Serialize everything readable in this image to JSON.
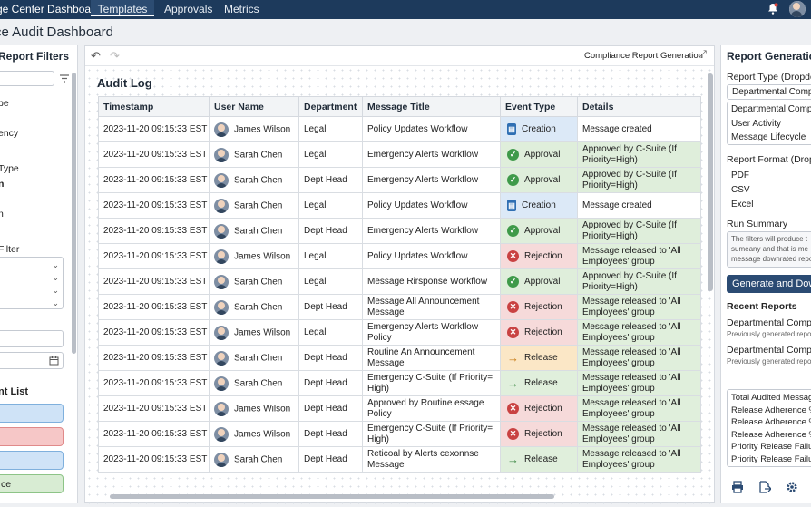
{
  "topbar": {
    "title": "ge Center Dashboard",
    "tabs": [
      "Templates",
      "Approvals",
      "Metrics"
    ]
  },
  "page_title": "ce Audit Dashboard",
  "left": {
    "heading": "Report Filters",
    "frag1": "pe",
    "frag2": "ency",
    "frag3": "Type",
    "frag4": "n",
    "frag5": "l",
    "frag6": "n",
    "filter_label": "Filter",
    "list_label": "nt List",
    "chip4": "ce"
  },
  "middle": {
    "breadcrumb": "Compliance Report Generation",
    "title": "Audit Log",
    "columns": [
      "Timestamp",
      "User Name",
      "Department",
      "Message Title",
      "Event Type",
      "Details"
    ],
    "rows": [
      [
        "2023-11-20 09:15:33 EST",
        "James Wilson",
        "Legal",
        "Policy Updates Workflow",
        "Creation",
        "Message created"
      ],
      [
        "2023-11-20 09:15:33 EST",
        "Sarah Chen",
        "Legal",
        "Emergency Alerts Workflow",
        "Approval",
        "Approved by C-Suite (If Priority=High)"
      ],
      [
        "2023-11-20 09:15:33 EST",
        "Sarah Chen",
        "Dept Head",
        "Emergency Alerts Workflow",
        "Approval",
        "Approved by C-Suite (If Priority=High)"
      ],
      [
        "2023-11-20 09:15:33 EST",
        "Sarah Chen",
        "Legal",
        "Policy Updates Workflow",
        "Creation",
        "Message created"
      ],
      [
        "2023-11-20 09:15:33 EST",
        "Sarah Chen",
        "Dept Head",
        "Emergency Alerts Workflow",
        "Approval",
        "Approved by C-Suite (If Priority=High)"
      ],
      [
        "2023-11-20 09:15:33 EST",
        "James Wilson",
        "Legal",
        "Policy Updates Workflow",
        "Rejection",
        "Message released to 'All Employees' group"
      ],
      [
        "2023-11-20 09:15:33 EST",
        "Sarah Chen",
        "Legal",
        "Message Rirsponse Workflow",
        "Approval",
        "Approved by C-Suite (If Priority=High)"
      ],
      [
        "2023-11-20 09:15:33 EST",
        "Sarah Chen",
        "Dept Head",
        "Message All Announcement Message",
        "Rejection",
        "Message released to 'All Employees' group"
      ],
      [
        "2023-11-20 09:15:33 EST",
        "James Wilson",
        "Legal",
        "Emergency Alerts Workflow Policy",
        "Rejection",
        "Message released to 'All Employees' group"
      ],
      [
        "2023-11-20 09:15:33 EST",
        "Sarah Chen",
        "Dept Head",
        "Routine An Announcement Message",
        "Release",
        "Message released to 'All Employees' group"
      ],
      [
        "2023-11-20 09:15:33 EST",
        "Sarah Chen",
        "Dept Head",
        "Emergency C-Suite (If Priority= High)",
        "Release",
        "Message released to 'All Employees' group"
      ],
      [
        "2023-11-20 09:15:33 EST",
        "James Wilson",
        "Dept Head",
        "Approved by Routine essage Policy",
        "Rejection",
        "Message released to 'All Employees' group"
      ],
      [
        "2023-11-20 09:15:33 EST",
        "James Wilson",
        "Dept Head",
        "Emergency C-Suite (If Priority= High)",
        "Rejection",
        "Message released to 'All Employees' group"
      ],
      [
        "2023-11-20 09:15:33 EST",
        "Sarah Chen",
        "Dept Head",
        "Reticoal by Alerts cexonnse Message",
        "Release",
        "Message released to 'All Employees' group"
      ]
    ]
  },
  "right": {
    "heading": "Report Generation",
    "type_label": "Report Type (Dropdow",
    "type_selected": "Departmental Complia",
    "type_opts": [
      "Departmental Complia",
      "User Activity",
      "Message Lifecycle"
    ],
    "format_label": "Report Format (Dropdo",
    "format_opts": [
      "PDF",
      "CSV",
      "Excel"
    ],
    "summary_label": "Run Summary",
    "summary_text": [
      "The filters will produce t",
      "sumeany and that is me",
      "message downrated repo"
    ],
    "gen_button": "Generate and Downlo",
    "recent_label": "Recent Reports",
    "recent": [
      {
        "t": "Departmental Complia",
        "s": "Previously generated repo"
      },
      {
        "t": "Departmental Complia",
        "s": "Previously generated repo"
      }
    ],
    "stats": [
      "Total Audited Message",
      "Release Adherence %",
      "Release Adherence %",
      "Release Adherence %",
      "Priority Release Failu",
      "Priority Release Failu"
    ]
  },
  "colors": {
    "creation": "#dce9f7",
    "approval": "#dfeedb",
    "rejection": "#f6dada",
    "release_amber": "#fbe7c6",
    "release_green": "#e0efdc"
  }
}
